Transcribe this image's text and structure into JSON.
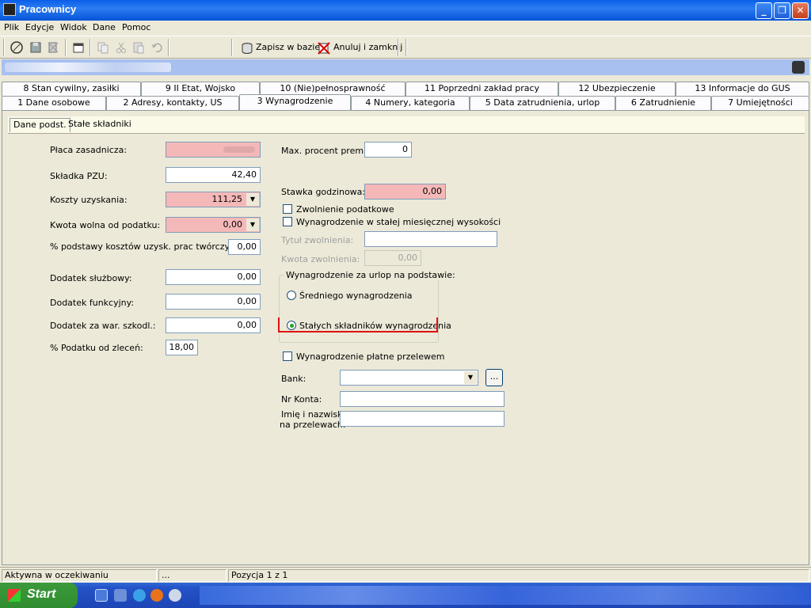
{
  "window": {
    "title": "Pracownicy",
    "min_label": "_",
    "max_label": "❐",
    "close_label": "✕"
  },
  "menu": [
    "Plik",
    "Edycje",
    "Widok",
    "Dane",
    "Pomoc"
  ],
  "toolbar": {
    "save_label": "Zapisz w bazie",
    "cancel_label": "Anuluj i zamknij"
  },
  "tabs_row1": [
    "8  Stan cywilny, zasiłki",
    "9  II Etat, Wojsko",
    "10  (Nie)pełnosprawność",
    "11  Poprzedni zakład pracy",
    "12  Ubezpieczenie",
    "13 Informacje do GUS"
  ],
  "tabs_row2": [
    "1 Dane osobowe",
    "2 Adresy, kontakty, US",
    "3  Wynagrodzenie",
    "4  Numery, kategoria",
    "5  Data zatrudnienia, urlop",
    "6  Zatrudnienie",
    "7  Umiejętności"
  ],
  "subtabs": [
    "Dane podst.",
    "Stałe składniki"
  ],
  "left": {
    "placa_label": "Płaca zasadnicza:",
    "pzu_label": "Składka PZU:",
    "pzu_value": "42,40",
    "koszty_label": "Koszty uzyskania:",
    "koszty_value": "111,25",
    "kwota_label": "Kwota wolna od podatku:",
    "kwota_value": "0,00",
    "procent_label": "% podstawy kosztów uzysk. prac twórczych:",
    "procent_value": "0,00",
    "sluzbowy_label": "Dodatek służbowy:",
    "sluzbowy_value": "0,00",
    "funkcyjny_label": "Dodatek funkcyjny:",
    "funkcyjny_value": "0,00",
    "szkodl_label": "Dodatek za war. szkodl.:",
    "szkodl_value": "0,00",
    "zlecen_label": "% Podatku od zleceń:",
    "zlecen_value": "18,00"
  },
  "right": {
    "premia_label": "Max. procent premii:",
    "premia_value": "0",
    "stawka_label": "Stawka godzinowa:",
    "stawka_value": "0,00",
    "zwolnienie_label": "Zwolnienie podatkowe",
    "stala_label": "Wynagrodzenie w stałej miesięcznej wysokości",
    "tytul_label": "Tytuł zwolnienia:",
    "kwota_zw_label": "Kwota zwolnienia:",
    "kwota_zw_value": "0,00",
    "group_label": "Wynagrodzenie za urlop na podstawie:",
    "radio1_label": "Średniego wynagrodzenia",
    "radio2_label": "Stałych składników wynagrodzenia",
    "przelew_label": "Wynagrodzenie płatne przelewem",
    "bank_label": "Bank:",
    "bank_button": "...",
    "konto_label": "Nr Konta:",
    "imie_label1": "Imię i nazwisko",
    "imie_label2": "na przelewach:"
  },
  "status": {
    "cell1": "Aktywna w oczekiwaniu",
    "cell2": "...",
    "cell3": "Pozycja 1 z 1"
  },
  "taskbar": {
    "start_label": "Start"
  }
}
